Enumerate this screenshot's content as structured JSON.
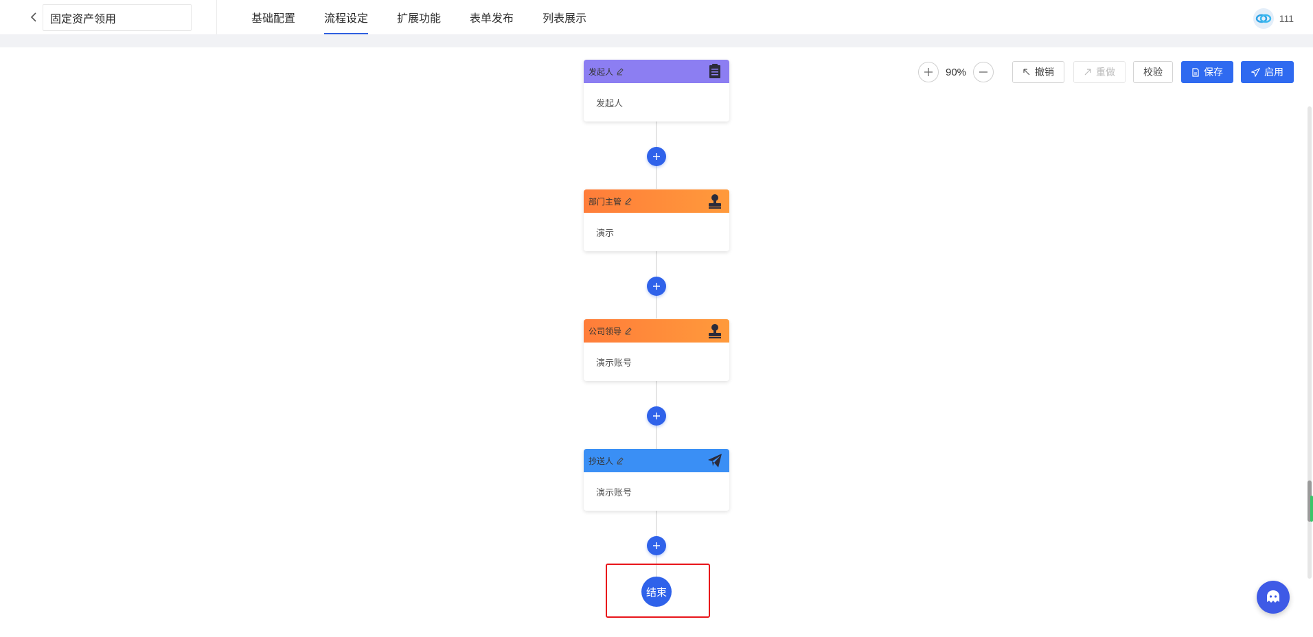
{
  "header": {
    "back_icon": "chevron-left-icon",
    "title": "固定资产领用",
    "tabs": [
      {
        "label": "基础配置",
        "active": false
      },
      {
        "label": "流程设定",
        "active": true
      },
      {
        "label": "扩展功能",
        "active": false
      },
      {
        "label": "表单发布",
        "active": false
      },
      {
        "label": "列表展示",
        "active": false
      }
    ],
    "user_name": "111"
  },
  "toolbar": {
    "zoom_in_icon": "plus-icon",
    "zoom": "90%",
    "zoom_out_icon": "minus-icon",
    "undo_label": "撤销",
    "redo_label": "重做",
    "validate_label": "校验",
    "save_label": "保存",
    "enable_label": "启用"
  },
  "flow": {
    "nodes": [
      {
        "title": "发起人",
        "content": "发起人",
        "icon": "clipboard-icon",
        "color": "#8c7ef2"
      },
      {
        "title": "部门主管",
        "content": "演示",
        "icon": "approver-stamp-icon",
        "color": "#ff8a3a"
      },
      {
        "title": "公司领导",
        "content": "演示账号",
        "icon": "approver-stamp-icon",
        "color": "#ff8a3a"
      },
      {
        "title": "抄送人",
        "content": "演示账号",
        "icon": "paper-plane-icon",
        "color": "#3a8ff5"
      }
    ],
    "end_label": "结束"
  },
  "colors": {
    "primary": "#2f62ea",
    "highlight": "#e8141a"
  }
}
